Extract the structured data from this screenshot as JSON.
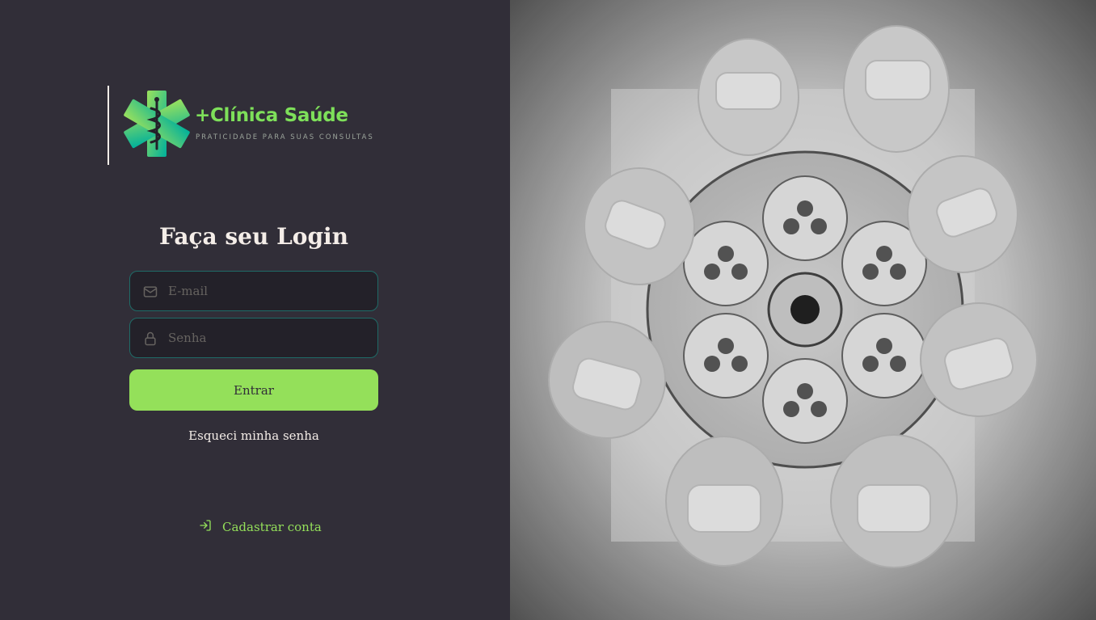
{
  "brand": {
    "name": "+Clínica Saúde",
    "tagline": "PRATICIDADE PARA SUAS CONSULTAS",
    "colors": {
      "accent": "#94e05a",
      "logo_gradient_start": "#9be15d",
      "logo_gradient_end": "#00b09b"
    }
  },
  "login": {
    "title": "Faça seu Login",
    "email_placeholder": "E-mail",
    "email_icon": "mail-icon",
    "password_placeholder": "Senha",
    "password_icon": "lock-icon",
    "submit_label": "Entrar",
    "forgot_label": "Esqueci minha senha"
  },
  "signup": {
    "label": "Cadastrar conta",
    "icon": "log-in-icon"
  },
  "hero": {
    "description_icon": "surgeons-photo"
  },
  "colors": {
    "background": "#312e38",
    "input_bg": "#232129",
    "input_border": "#1f6b67",
    "text": "#f4ede8",
    "placeholder": "#666360"
  }
}
